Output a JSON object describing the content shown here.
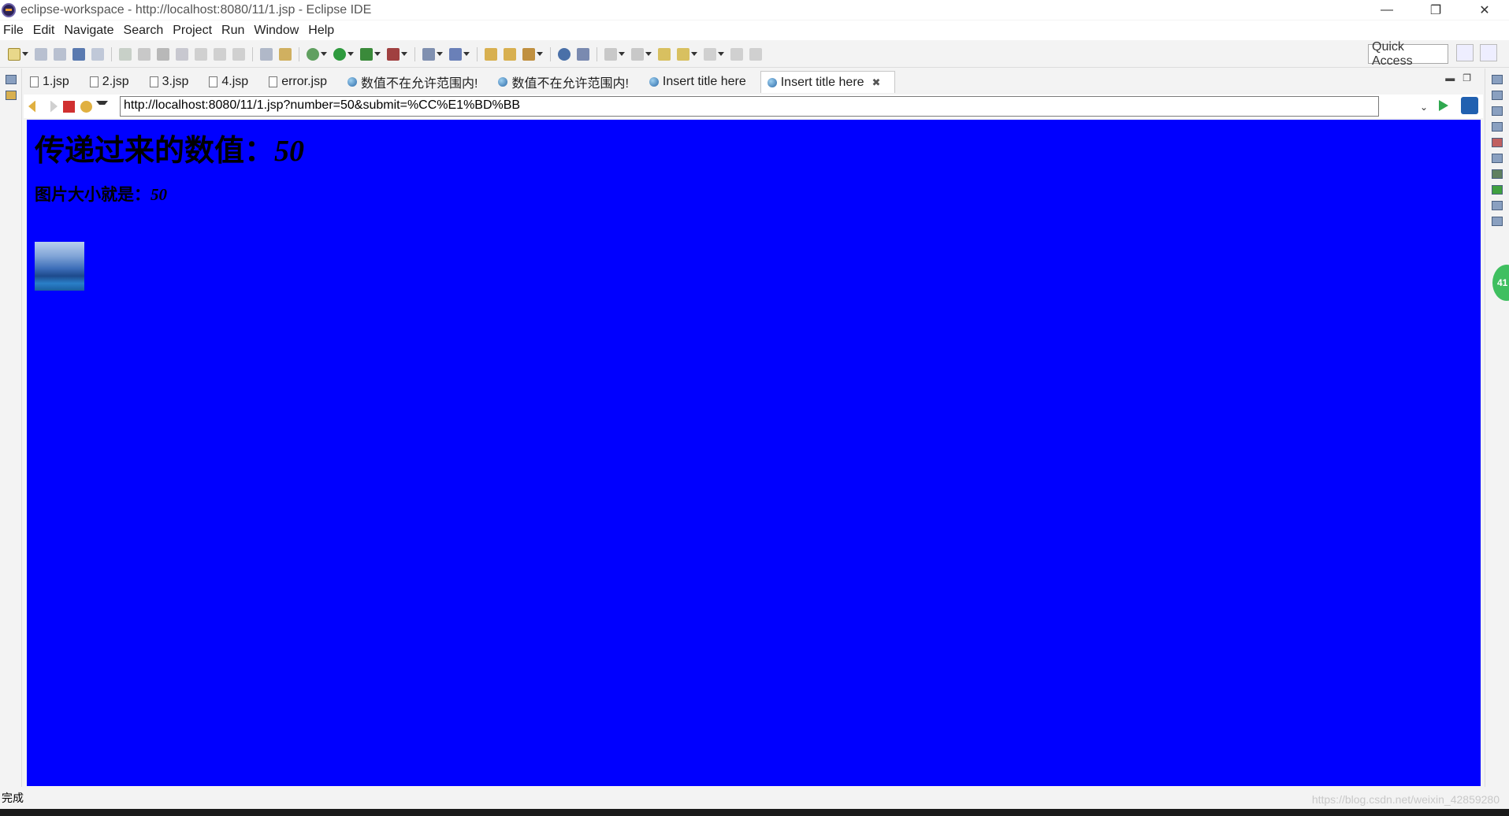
{
  "window": {
    "title": "eclipse-workspace - http://localhost:8080/11/1.jsp - Eclipse IDE"
  },
  "menu": [
    "File",
    "Edit",
    "Navigate",
    "Search",
    "Project",
    "Run",
    "Window",
    "Help"
  ],
  "toolbar": {
    "quick_access": "Quick Access"
  },
  "tabs": [
    {
      "label": "1.jsp",
      "icon": "file-icon",
      "active": false
    },
    {
      "label": "2.jsp",
      "icon": "file-icon",
      "active": false
    },
    {
      "label": "3.jsp",
      "icon": "file-icon",
      "active": false
    },
    {
      "label": "4.jsp",
      "icon": "file-icon",
      "active": false
    },
    {
      "label": "error.jsp",
      "icon": "file-icon",
      "active": false
    },
    {
      "label": "数值不在允许范围内!",
      "icon": "globe-icon",
      "active": false
    },
    {
      "label": "数值不在允许范围内!",
      "icon": "globe-icon",
      "active": false
    },
    {
      "label": "Insert title here",
      "icon": "globe-icon",
      "active": false
    },
    {
      "label": "Insert title here",
      "icon": "globe-icon",
      "active": true
    }
  ],
  "browser": {
    "url": "http://localhost:8080/11/1.jsp?number=50&submit=%CC%E1%BD%BB",
    "background": "#0000ff",
    "heading_label": "传递过来的数值：",
    "heading_value": "50",
    "subheading_label": "图片大小就是：",
    "subheading_value": "50"
  },
  "status": {
    "text": "完成",
    "watermark": "https://blog.csdn.net/weixin_42859280"
  },
  "badge": "41"
}
